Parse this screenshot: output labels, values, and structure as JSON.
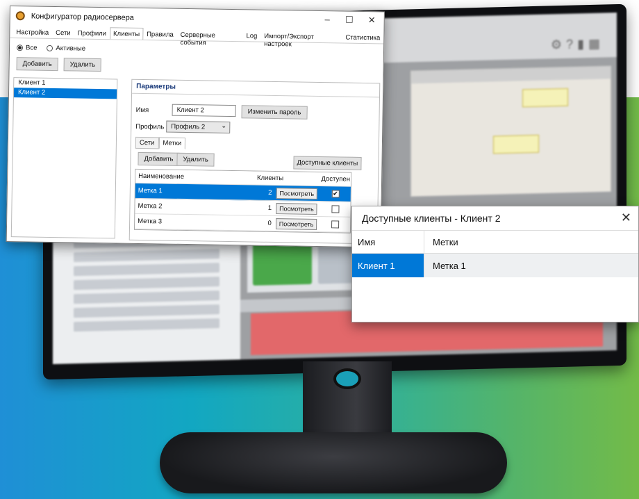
{
  "window": {
    "title": "Конфигуратор радиосервера",
    "controls": {
      "minimize": "–",
      "maximize": "☐",
      "close": "✕"
    },
    "menu": [
      "Настройка",
      "Сети",
      "Профили",
      "Клиенты",
      "Правила",
      "Серверные события",
      "Log",
      "Импорт/Экспорт настроек",
      "Статистика"
    ],
    "active_menu": "Клиенты"
  },
  "filter": {
    "all_label": "Все",
    "active_label": "Активные",
    "selected": "Все"
  },
  "toolbar": {
    "add": "Добавить",
    "delete": "Удалить"
  },
  "clients": [
    {
      "name": "Клиент 1",
      "selected": false
    },
    {
      "name": "Клиент 2",
      "selected": true
    }
  ],
  "params": {
    "heading": "Параметры",
    "name_label": "Имя",
    "name_value": "Клиент 2",
    "change_password": "Изменить пароль",
    "profile_label": "Профиль",
    "profile_value": "Профиль 2",
    "dropdown_icon": "⌄",
    "subtabs": [
      "Сети",
      "Метки"
    ],
    "active_subtab": "Метки",
    "add": "Добавить",
    "delete": "Удалить",
    "available_clients": "Доступные клиенты"
  },
  "tags_table": {
    "headers": [
      "Наименование",
      "Клиенты",
      "Доступен"
    ],
    "rows": [
      {
        "name": "Метка 1",
        "count": "2",
        "view": "Посмотреть",
        "available": true,
        "selected": true
      },
      {
        "name": "Метка 2",
        "count": "1",
        "view": "Посмотреть",
        "available": false,
        "selected": false
      },
      {
        "name": "Метка 3",
        "count": "0",
        "view": "Посмотреть",
        "available": false,
        "selected": false
      }
    ]
  },
  "popup": {
    "title": "Доступные клиенты - Клиент 2",
    "close": "✕",
    "headers": [
      "Имя",
      "Метки"
    ],
    "rows": [
      {
        "name": "Клиент 1",
        "tags": "Метка 1"
      }
    ]
  },
  "colors": {
    "selection": "#0078d7",
    "gradient_left": "#1f8fd6",
    "gradient_right": "#73bb48"
  }
}
